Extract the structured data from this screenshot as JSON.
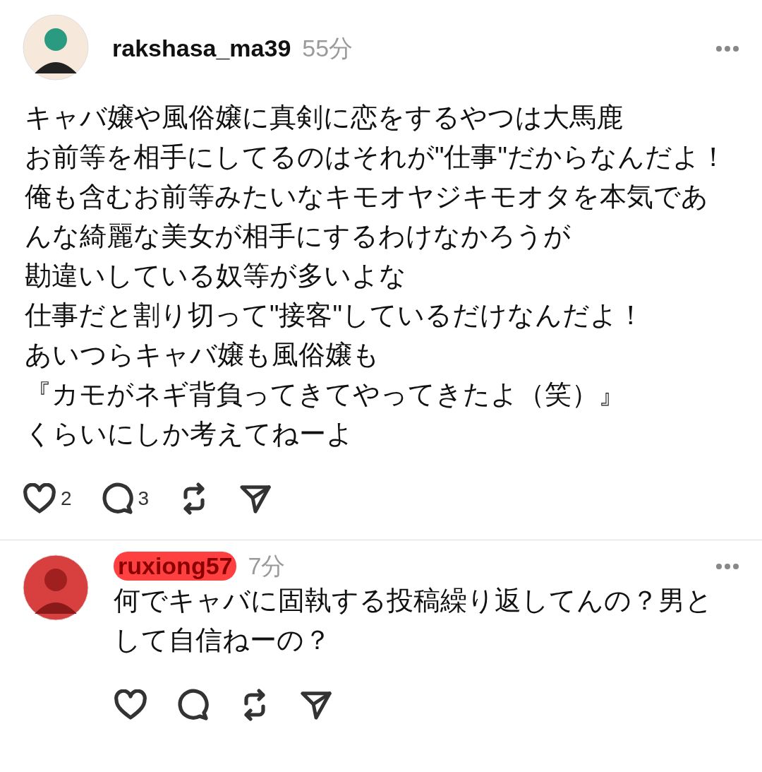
{
  "posts": [
    {
      "username": "rakshasa_ma39",
      "time": "55分",
      "redacted": false,
      "lines": [
        "キャバ嬢や風俗嬢に真剣に恋をするやつは大馬鹿",
        "お前等を相手にしてるのはそれが\"仕事\"だからなんだよ！",
        "俺も含むお前等みたいなキモオヤジキモオタを本気であんな綺麗な美女が相手にするわけなかろうが",
        "勘違いしている奴等が多いよな",
        "仕事だと割り切って\"接客\"しているだけなんだよ！",
        "あいつらキャバ嬢も風俗嬢も",
        "『カモがネギ背負ってきてやってきたよ（笑）』",
        "くらいにしか考えてねーよ"
      ],
      "likes": "2",
      "replies": "3"
    },
    {
      "username": "ruxiong57",
      "time": "7分",
      "redacted": true,
      "lines": [
        "何でキャバに固執する投稿繰り返してんの？男として自信ねーの？"
      ]
    }
  ]
}
